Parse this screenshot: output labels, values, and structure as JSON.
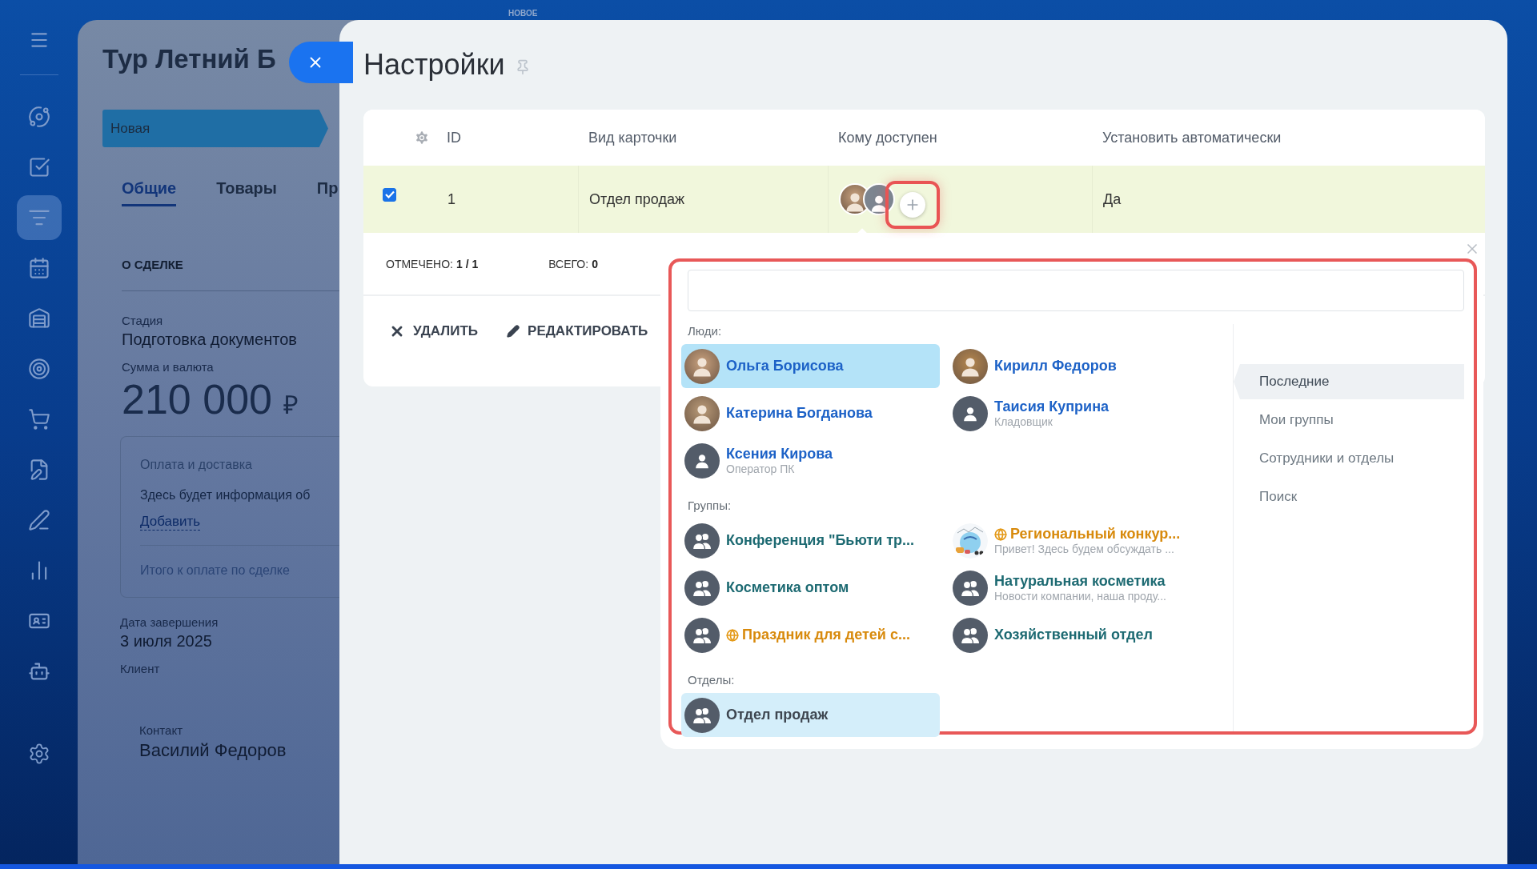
{
  "top_tab": "НОВОЕ",
  "sidebar": {
    "items": [
      {
        "selected": false
      },
      {
        "selected": false
      },
      {
        "selected": true
      },
      {
        "selected": false
      },
      {
        "selected": false
      },
      {
        "selected": false
      },
      {
        "selected": false
      },
      {
        "selected": false
      },
      {
        "selected": false
      },
      {
        "selected": false
      },
      {
        "selected": false
      },
      {
        "selected": false
      }
    ]
  },
  "deal": {
    "title": "Тур Летний Б",
    "stage": "Новая",
    "tabs": [
      {
        "label": "Общие",
        "selected": true
      },
      {
        "label": "Товары",
        "selected": false
      },
      {
        "label": "Пр",
        "selected": false
      }
    ],
    "section": "О СДЕЛКЕ",
    "stage_label": "Стадия",
    "stage_value": "Подготовка документов",
    "amount_label": "Сумма и валюта",
    "amount": "210 000",
    "currency": "₽",
    "payment": {
      "title": "Оплата и доставка",
      "info": "Здесь будет информация об",
      "link": "Добавить",
      "total": "Итого к оплате по сделке"
    },
    "date_label": "Дата завершения",
    "date": "3 июля 2025",
    "client_label": "Клиент",
    "contact_label": "Контакт",
    "contact": "Василий Федоров"
  },
  "settings": {
    "title": "Настройки",
    "table": {
      "columns": [
        "ID",
        "Вид карточки",
        "Кому доступен",
        "Установить автоматически"
      ],
      "rows": [
        {
          "checked": true,
          "id": "1",
          "card_type": "Отдел продаж",
          "auto": "Да"
        }
      ],
      "footer": {
        "checked_label": "ОТМЕЧЕНО:",
        "checked_value": "1 / 1",
        "total_label": "ВСЕГО:",
        "total_value": "0"
      },
      "actions": [
        "УДАЛИТЬ",
        "РЕДАКТИРОВАТЬ"
      ]
    }
  },
  "picker": {
    "sections": [
      {
        "label": "Люди:",
        "kind": "people",
        "items": [
          {
            "name": "Ольга Борисова",
            "selected": true
          },
          {
            "name": "Кирилл Федоров",
            "selected": false
          },
          {
            "name": "Катерина Богданова",
            "selected": false
          },
          {
            "name": "Таисия Куприна",
            "subtitle": "Кладовщик",
            "selected": false,
            "kind": "user"
          },
          {
            "name": "Ксения Кирова",
            "subtitle": "Оператор ПК",
            "selected": false,
            "kind": "user"
          }
        ]
      },
      {
        "label": "Группы:",
        "kind": "groups",
        "items": [
          {
            "name": "Конференция \"Бьюти тр...",
            "selected": false,
            "kind": "group",
            "extranet": false
          },
          {
            "name": "Региональный конкур...",
            "subtitle": "Привет! Здесь будем обсуждать ...",
            "selected": false,
            "kind": "picture",
            "extranet": true
          },
          {
            "name": "Косметика оптом",
            "selected": false,
            "kind": "group",
            "extranet": false
          },
          {
            "name": "Натуральная косметика",
            "subtitle": "Новости компании, наша проду...",
            "selected": false,
            "kind": "group",
            "extranet": false
          },
          {
            "name": "Праздник для детей с...",
            "selected": false,
            "kind": "group",
            "extranet": true
          },
          {
            "name": "Хозяйственный отдел",
            "selected": false,
            "kind": "group",
            "extranet": false
          }
        ]
      },
      {
        "label": "Отделы:",
        "kind": "departments",
        "items": [
          {
            "name": "Отдел продаж",
            "selected": true,
            "kind": "group"
          }
        ]
      }
    ],
    "nav": [
      {
        "label": "Последние",
        "selected": true
      },
      {
        "label": "Мои группы",
        "selected": false
      },
      {
        "label": "Сотрудники и отделы",
        "selected": false
      },
      {
        "label": "Поиск",
        "selected": false
      }
    ]
  }
}
